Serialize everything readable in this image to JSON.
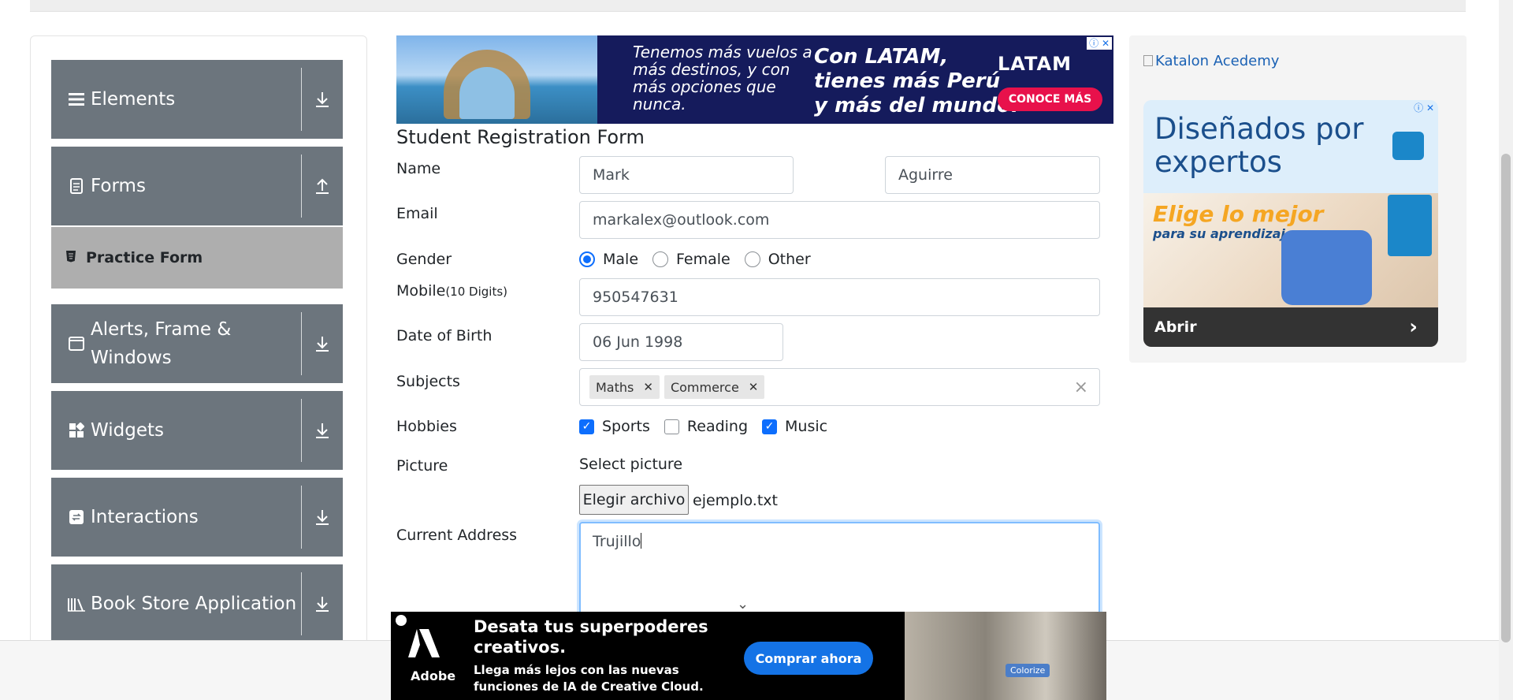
{
  "sidebar": {
    "groups": [
      {
        "label": "Elements",
        "icon": "hamburger-icon"
      },
      {
        "label": "Forms",
        "icon": "document-icon"
      },
      {
        "label": "Alerts, Frame & Windows",
        "icon": "window-icon"
      },
      {
        "label": "Widgets",
        "icon": "widgets-icon"
      },
      {
        "label": "Interactions",
        "icon": "interactions-icon"
      },
      {
        "label": "Book Store Application",
        "icon": "books-icon"
      }
    ],
    "active_item": {
      "label": "Practice Form",
      "icon": "html-icon"
    }
  },
  "form": {
    "title": "Student Registration Form",
    "name_label": "Name",
    "first_name": "Mark",
    "last_name": "Aguirre",
    "email_label": "Email",
    "email": "markalex@outlook.com",
    "gender_label": "Gender",
    "gender_options": [
      "Male",
      "Female",
      "Other"
    ],
    "gender_selected": "Male",
    "mobile_label": "Mobile",
    "mobile_hint": "(10 Digits)",
    "mobile": "950547631",
    "dob_label": "Date of Birth",
    "dob": "06 Jun 1998",
    "subjects_label": "Subjects",
    "subjects": [
      "Maths",
      "Commerce"
    ],
    "subjects_clear": "×",
    "hobbies_label": "Hobbies",
    "hobbies": [
      {
        "label": "Sports",
        "checked": true
      },
      {
        "label": "Reading",
        "checked": false
      },
      {
        "label": "Music",
        "checked": true
      }
    ],
    "picture_label": "Picture",
    "select_picture": "Select picture",
    "file_button": "Elegir archivo",
    "file_name": "ejemplo.txt",
    "address_label": "Current Address",
    "address": "Trujillo"
  },
  "ads": {
    "top": {
      "text1": "Tenemos más vuelos a más destinos, y con más opciones que nunca.",
      "text2_l1": "Con LATAM,",
      "text2_l2": "tienes más Perú",
      "text2_l3": "y más del mundo.",
      "brand": "LATAM",
      "cta": "CONOCE MÁS"
    },
    "right": {
      "broken_image_alt": "Katalon Acedemy",
      "headline": "Diseñados por expertos",
      "sub1": "Elige lo mejor",
      "sub2": "para su aprendizaje.",
      "cta": "Abrir"
    },
    "bottom": {
      "brand": "Adobe",
      "headline": "Desata tus superpoderes creativos.",
      "body": "Llega más lejos con las nuevas funciones de IA de Creative Cloud.",
      "cta": "Comprar ahora",
      "tag": "Colorize"
    }
  },
  "colors": {
    "sidebar": "#6c757d",
    "active": "#aeaeae",
    "primary": "#0d6efd"
  }
}
